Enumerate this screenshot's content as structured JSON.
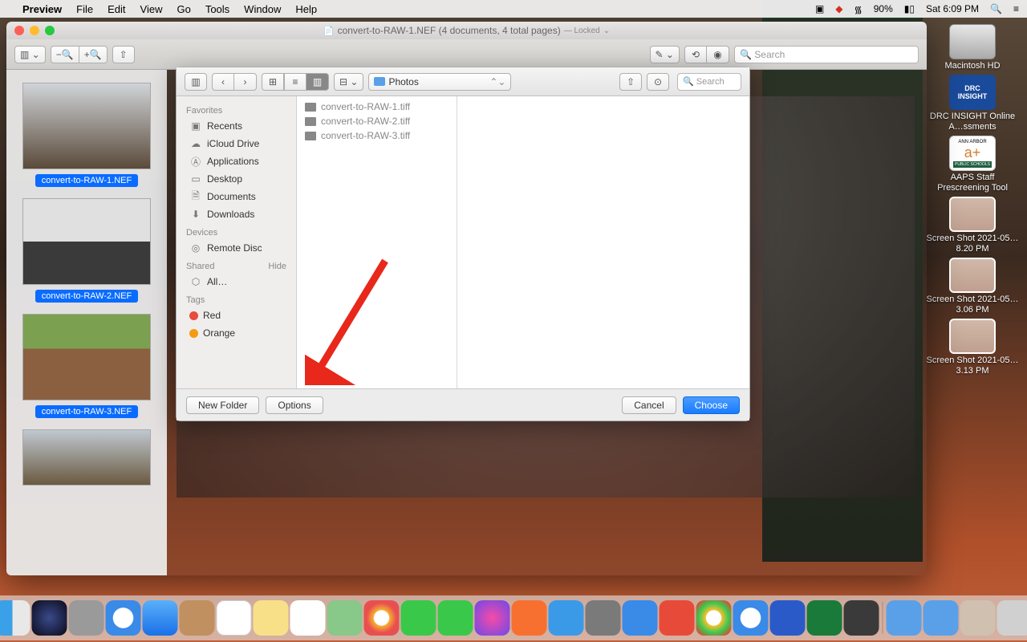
{
  "menubar": {
    "app": "Preview",
    "items": [
      "File",
      "Edit",
      "View",
      "Go",
      "Tools",
      "Window",
      "Help"
    ],
    "battery": "90%",
    "clock": "Sat 6:09 PM"
  },
  "window": {
    "title": "convert-to-RAW-1.NEF (4 documents, 4 total pages)",
    "locked": "— Locked",
    "search_placeholder": "Search"
  },
  "thumbs": [
    "convert-to-RAW-1.NEF",
    "convert-to-RAW-2.NEF",
    "convert-to-RAW-3.NEF"
  ],
  "panel": {
    "folder": "Photos",
    "search_placeholder": "Search",
    "sidebar": {
      "favorites_head": "Favorites",
      "favorites": [
        "Recents",
        "iCloud Drive",
        "Applications",
        "Desktop",
        "Documents",
        "Downloads"
      ],
      "devices_head": "Devices",
      "devices": [
        "Remote Disc"
      ],
      "shared_head": "Shared",
      "hide": "Hide",
      "shared": [
        "All…"
      ],
      "tags_head": "Tags",
      "tags": [
        "Red",
        "Orange"
      ]
    },
    "files": [
      "convert-to-RAW-1.tiff",
      "convert-to-RAW-2.tiff",
      "convert-to-RAW-3.tiff"
    ],
    "new_folder": "New Folder",
    "options": "Options",
    "cancel": "Cancel",
    "choose": "Choose"
  },
  "desktop": {
    "hdd": "Macintosh HD",
    "drc": "DRC INSIGHT Online A…ssments",
    "aaps": "AAPS Staff Prescreening Tool",
    "ss1": "Screen Shot 2021-05…8.20 PM",
    "ss2": "Screen Shot 2021-05…3.06 PM",
    "ss3": "Screen Shot 2021-05…3.13 PM"
  }
}
